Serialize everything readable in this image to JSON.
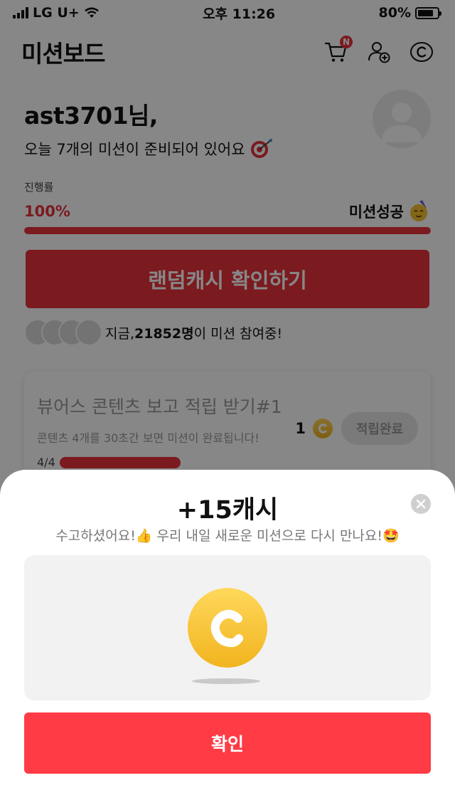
{
  "status_bar": {
    "carrier": "LG U+",
    "time": "오후 11:26",
    "battery": "80%"
  },
  "header": {
    "title": "미션보드",
    "cart_badge": "N",
    "icons": [
      "cart-icon",
      "add-friend-icon",
      "cash-icon"
    ]
  },
  "greeting": {
    "name": "ast3701님,",
    "subtitle": "오늘 7개의 미션이 준비되어 있어요"
  },
  "progress": {
    "label": "진행률",
    "percent_text": "100%",
    "value": 1.0,
    "status": "미션성공"
  },
  "cash_button": {
    "label": "랜덤캐시 확인하기"
  },
  "participants": {
    "prefix": "지금, ",
    "count": "21852명",
    "suffix": "이 미션 참여중!"
  },
  "mission": {
    "title": "뷰어스 콘텐츠 보고 적립 받기#1",
    "description": "콘텐츠 4개를 30초간 보면 미션이 완료됩니다!",
    "progress_text": "4/4",
    "reward": "1",
    "status_button": "적립완료"
  },
  "sheet": {
    "title": "+15캐시",
    "message": "수고하셨어요!👍 우리 내일 새로운 미션으로 다시 만나요!🤩",
    "confirm": "확인"
  },
  "colors": {
    "accent": "#e8323c",
    "confirm": "#ff3b46",
    "coin": "#f5c22e"
  }
}
